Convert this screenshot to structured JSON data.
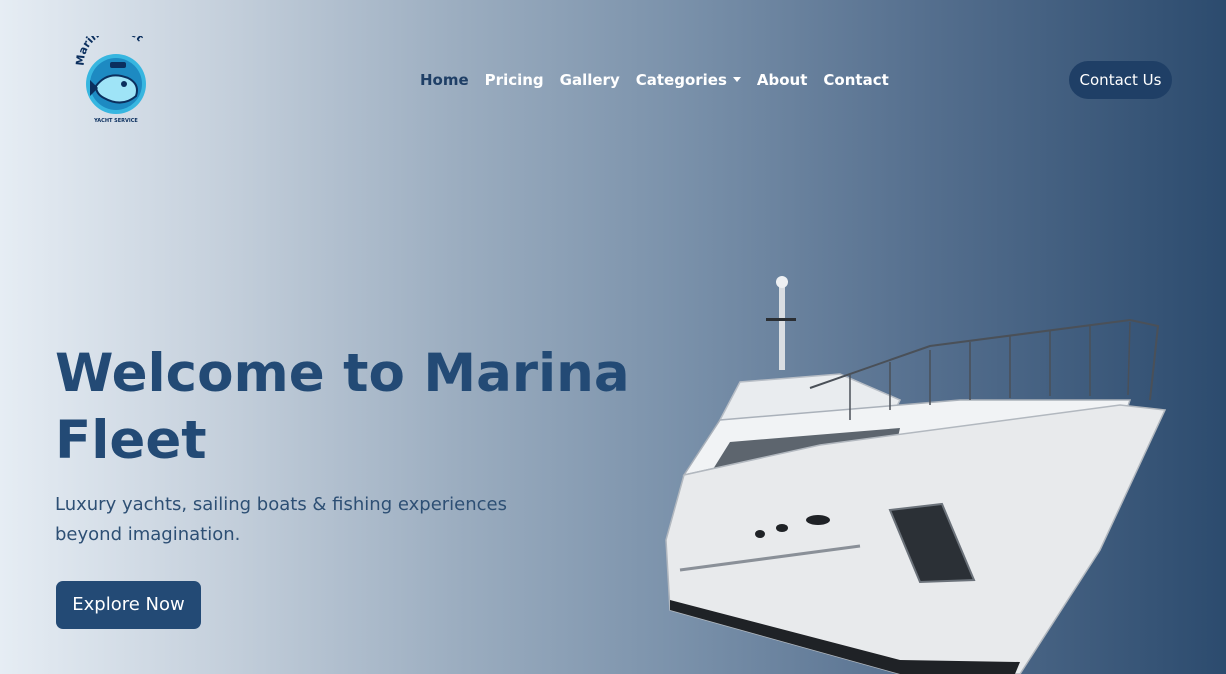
{
  "brand": {
    "name": "Marina Fleet",
    "tagline": "YACHT SERVICE"
  },
  "nav": {
    "items": [
      {
        "label": "Home",
        "active": true
      },
      {
        "label": "Pricing"
      },
      {
        "label": "Gallery"
      },
      {
        "label": "Categories"
      },
      {
        "label": "About"
      },
      {
        "label": "Contact"
      }
    ]
  },
  "header": {
    "contact_label": "Contact Us"
  },
  "hero": {
    "title": "Welcome to Marina Fleet",
    "subtitle": "Luxury yachts, sailing boats & fishing experiences beyond imagination.",
    "cta_label": "Explore Now"
  },
  "colors": {
    "primary": "#234a75",
    "nav_active": "#1f3f66",
    "gradient_start": "#e6edf4",
    "gradient_end": "#2c4b6e"
  },
  "icons": {
    "logo": "fish-mascot-logo",
    "dropdown": "caret-down-icon"
  }
}
